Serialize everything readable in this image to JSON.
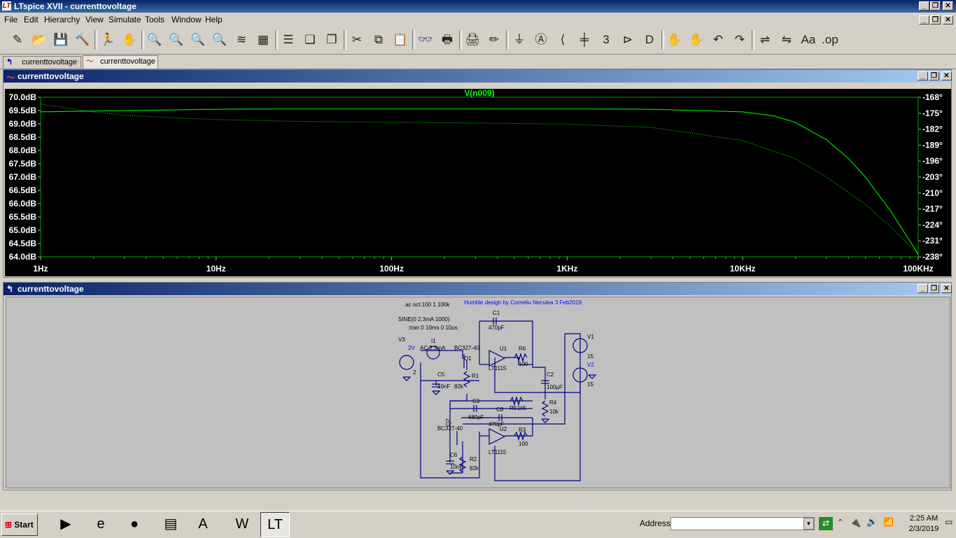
{
  "window": {
    "title": "LTspice XVII - currenttovoltage",
    "min_label": "_",
    "restore_label": "❐",
    "close_label": "✕"
  },
  "menu": [
    {
      "label": "File"
    },
    {
      "label": "Edit"
    },
    {
      "label": "Hierarchy"
    },
    {
      "label": "View"
    },
    {
      "label": "Simulate"
    },
    {
      "label": "Tools"
    },
    {
      "label": "Window"
    },
    {
      "label": "Help"
    }
  ],
  "toolbar": [
    {
      "name": "new-schematic-icon",
      "glyph": "✎"
    },
    {
      "name": "open-icon",
      "glyph": "📂"
    },
    {
      "name": "save-icon",
      "glyph": "💾"
    },
    {
      "name": "control-panel-icon",
      "glyph": "🔨"
    },
    {
      "name": "run-icon",
      "glyph": "🏃"
    },
    {
      "name": "halt-icon",
      "glyph": "✋"
    },
    {
      "name": "zoom-in-icon",
      "glyph": "🔍"
    },
    {
      "name": "pan-icon",
      "glyph": "🔍"
    },
    {
      "name": "zoom-out-icon",
      "glyph": "🔍"
    },
    {
      "name": "zoom-fit-icon",
      "glyph": "🔍"
    },
    {
      "name": "autorange-icon",
      "glyph": "≋"
    },
    {
      "name": "quick-pan-icon",
      "glyph": "▦"
    },
    {
      "name": "tile-horizontal-icon",
      "glyph": "☰"
    },
    {
      "name": "cascade-icon",
      "glyph": "❏"
    },
    {
      "name": "tile-vertical-icon",
      "glyph": "❐"
    },
    {
      "name": "cut-icon",
      "glyph": "✂"
    },
    {
      "name": "copy-icon",
      "glyph": "⧉"
    },
    {
      "name": "paste-icon",
      "glyph": "📋"
    },
    {
      "name": "find-icon",
      "glyph": "👓"
    },
    {
      "name": "print-preview-icon",
      "glyph": "🖶"
    },
    {
      "name": "print-icon",
      "glyph": "🖨"
    },
    {
      "name": "draw-wire-icon",
      "glyph": "✏"
    },
    {
      "name": "ground-icon",
      "glyph": "⏚"
    },
    {
      "name": "label-net-icon",
      "glyph": "Ⓐ"
    },
    {
      "name": "resistor-icon",
      "glyph": "⟨"
    },
    {
      "name": "capacitor-icon",
      "glyph": "╪"
    },
    {
      "name": "inductor-icon",
      "glyph": "3"
    },
    {
      "name": "diode-icon",
      "glyph": "⊳"
    },
    {
      "name": "component-icon",
      "glyph": "D"
    },
    {
      "name": "move-icon",
      "glyph": "✋"
    },
    {
      "name": "drag-icon",
      "glyph": "✋"
    },
    {
      "name": "undo-icon",
      "glyph": "↶"
    },
    {
      "name": "redo-icon",
      "glyph": "↷"
    },
    {
      "name": "rotate-icon",
      "glyph": "⇌"
    },
    {
      "name": "mirror-icon",
      "glyph": "⇋"
    },
    {
      "name": "text-icon",
      "glyph": "Aa"
    },
    {
      "name": "spice-directive-icon",
      "glyph": ".op"
    }
  ],
  "tabs": [
    {
      "label": "currenttovoltage",
      "kind": "schematic"
    },
    {
      "label": "currenttovoltage",
      "kind": "waveform"
    }
  ],
  "plot_pane": {
    "title": "currenttovoltage"
  },
  "schematic_pane": {
    "title": "currenttovoltage"
  },
  "chart_data": {
    "type": "line",
    "title": "V(n009)",
    "x_scale": "log",
    "xlim": [
      1,
      100000
    ],
    "x_tick_labels": [
      "1Hz",
      "10Hz",
      "100Hz",
      "1KHz",
      "10KHz",
      "100KHz"
    ],
    "x_ticks": [
      1,
      10,
      100,
      1000,
      10000,
      100000
    ],
    "ylim": [
      64.0,
      70.0
    ],
    "y_tick_labels": [
      "70.0dB",
      "69.5dB",
      "69.0dB",
      "68.5dB",
      "68.0dB",
      "67.5dB",
      "67.0dB",
      "66.5dB",
      "66.0dB",
      "65.5dB",
      "65.0dB",
      "64.5dB",
      "64.0dB"
    ],
    "y2lim": [
      -168,
      -238
    ],
    "y2_tick_labels": [
      "-168°",
      "-175°",
      "-182°",
      "-189°",
      "-196°",
      "-203°",
      "-210°",
      "-217°",
      "-224°",
      "-231°",
      "-238°"
    ],
    "series": [
      {
        "name": "V(n009)",
        "axis": "y",
        "style": "solid",
        "x": [
          1,
          2,
          5,
          10,
          30,
          100,
          300,
          1000,
          3000,
          10000,
          15000,
          20000,
          30000,
          40000,
          50000,
          70000,
          100000
        ],
        "y": [
          69.45,
          69.48,
          69.52,
          69.55,
          69.56,
          69.56,
          69.56,
          69.56,
          69.55,
          69.45,
          69.3,
          69.05,
          68.4,
          67.7,
          67.0,
          65.7,
          64.1
        ]
      },
      {
        "name": "V(n009) phase",
        "axis": "y2",
        "style": "dotted",
        "x": [
          1,
          1.5,
          2,
          3,
          5,
          10,
          30,
          100,
          300,
          1000,
          3000,
          10000,
          20000,
          30000,
          50000,
          70000,
          100000
        ],
        "y": [
          -171,
          -173,
          -174.5,
          -175.8,
          -176.8,
          -177.8,
          -178.6,
          -179,
          -179.3,
          -179.8,
          -181.2,
          -187,
          -195,
          -203,
          -215,
          -225,
          -237
        ]
      }
    ],
    "colors": {
      "background": "#000000",
      "trace": "#00ff00",
      "axis_text": "#ffffff",
      "frame": "#00cc00"
    }
  },
  "schematic": {
    "directives": [
      ".ac oct 100 1 100k",
      "SINE(0 2.3mA 1000)",
      ";tran 0 10ms 0 10us"
    ],
    "comment": "Humble design by Corneliu Neculea 3 Feb2019",
    "labels": [
      {
        "id": "c1",
        "text": "C1"
      },
      {
        "id": "c1v",
        "text": "470pF"
      },
      {
        "id": "v3",
        "text": "V3"
      },
      {
        "id": "v3v",
        "text": "2V"
      },
      {
        "id": "v3n",
        "text": "2"
      },
      {
        "id": "i1",
        "text": "I1"
      },
      {
        "id": "i1v",
        "text": "AC 2.3mA"
      },
      {
        "id": "q1t",
        "text": "BC327-40"
      },
      {
        "id": "q1",
        "text": "Q1"
      },
      {
        "id": "u1",
        "text": "U1"
      },
      {
        "id": "u1t",
        "text": "LT1115"
      },
      {
        "id": "r6",
        "text": "R6"
      },
      {
        "id": "r6v",
        "text": "100"
      },
      {
        "id": "v1",
        "text": "V1"
      },
      {
        "id": "v1v",
        "text": "15"
      },
      {
        "id": "v2",
        "text": "V2"
      },
      {
        "id": "v2v",
        "text": "15"
      },
      {
        "id": "c5",
        "text": "C5"
      },
      {
        "id": "c5v",
        "text": "10nF"
      },
      {
        "id": "r1",
        "text": "R1"
      },
      {
        "id": "r1v",
        "text": "82k"
      },
      {
        "id": "c2",
        "text": "C2"
      },
      {
        "id": "c2v",
        "text": "100µF"
      },
      {
        "id": "c3",
        "text": "C3"
      },
      {
        "id": "c3v",
        "text": "680pF"
      },
      {
        "id": "r5",
        "text": "R5"
      },
      {
        "id": "r5v",
        "text": "1k5"
      },
      {
        "id": "r4",
        "text": "R4"
      },
      {
        "id": "r4v",
        "text": "10k"
      },
      {
        "id": "c8",
        "text": "C8"
      },
      {
        "id": "c8v",
        "text": "470pF"
      },
      {
        "id": "q2t",
        "text": "BC327-40"
      },
      {
        "id": "q2",
        "text": "Q2"
      },
      {
        "id": "u2",
        "text": "U2"
      },
      {
        "id": "u2t",
        "text": "LT1115"
      },
      {
        "id": "r3",
        "text": "R3"
      },
      {
        "id": "r3v",
        "text": "100"
      },
      {
        "id": "c6",
        "text": "C6"
      },
      {
        "id": "c6v",
        "text": "10nF"
      },
      {
        "id": "r2",
        "text": "R2"
      },
      {
        "id": "r2v",
        "text": "82k"
      }
    ]
  },
  "taskbar": {
    "start_label": "Start",
    "apps": [
      {
        "name": "media-player-icon",
        "glyph": "▶"
      },
      {
        "name": "internet-explorer-icon",
        "glyph": "e"
      },
      {
        "name": "firefox-icon",
        "glyph": "●"
      },
      {
        "name": "explorer-icon",
        "glyph": "▤"
      },
      {
        "name": "acrobat-icon",
        "glyph": "A"
      },
      {
        "name": "word-icon",
        "glyph": "W"
      },
      {
        "name": "ltspice-icon",
        "glyph": "LT"
      }
    ],
    "address_label": "Address",
    "address_value": "",
    "time": "2:25 AM",
    "date": "2/3/2019"
  }
}
